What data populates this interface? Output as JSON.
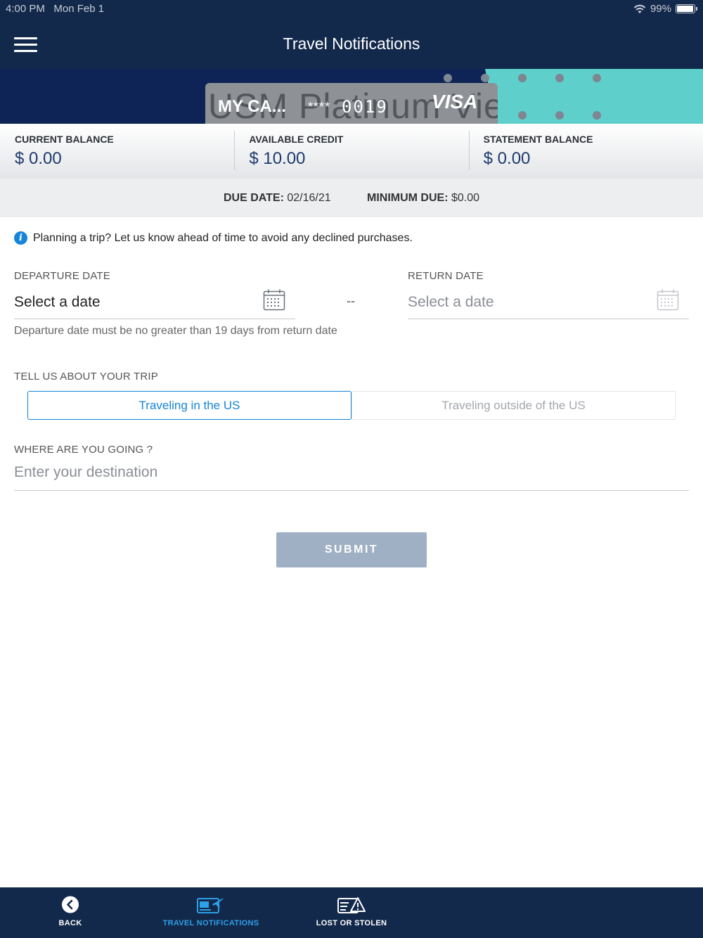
{
  "status_bar": {
    "time": "4:00 PM",
    "date": "Mon Feb 1",
    "battery": "99%"
  },
  "header": {
    "title": "Travel Notifications"
  },
  "card": {
    "background_text": "USM Platinum View",
    "name": "MY CA...",
    "masked": "****",
    "last4": "0019",
    "network": "VISA"
  },
  "balances": [
    {
      "label": "CURRENT BALANCE",
      "value": "$ 0.00"
    },
    {
      "label": "AVAILABLE CREDIT",
      "value": "$ 10.00"
    },
    {
      "label": "STATEMENT BALANCE",
      "value": "$ 0.00"
    }
  ],
  "due": {
    "due_date_label": "DUE DATE:",
    "due_date": "02/16/21",
    "min_due_label": "MINIMUM DUE:",
    "min_due": "$0.00"
  },
  "info_message": "Planning a trip? Let us know ahead of time to avoid any declined purchases.",
  "departure": {
    "label": "DEPARTURE DATE",
    "value": "Select a date"
  },
  "separator": "--",
  "return": {
    "label": "RETURN DATE",
    "value": "Select a date"
  },
  "date_hint": "Departure date must be no greater than 19 days from return date",
  "trip": {
    "label": "TELL US ABOUT YOUR TRIP",
    "options": [
      "Traveling in the US",
      "Traveling outside of the US"
    ],
    "selected": "Traveling in the US"
  },
  "destination": {
    "label": "WHERE ARE YOU GOING ?",
    "placeholder": "Enter your destination",
    "value": ""
  },
  "submit_label": "SUBMIT",
  "bottom_nav": [
    {
      "label": "BACK",
      "icon": "back-arrow-icon"
    },
    {
      "label": "TRAVEL NOTIFICATIONS",
      "icon": "travel-card-plane-icon",
      "active": true
    },
    {
      "label": "LOST OR STOLEN",
      "icon": "card-warning-icon"
    }
  ],
  "colors": {
    "navy": "#13294b",
    "accent_blue": "#1584d9",
    "teal": "#5ecfca",
    "submit_disabled": "#9fb0c4"
  }
}
